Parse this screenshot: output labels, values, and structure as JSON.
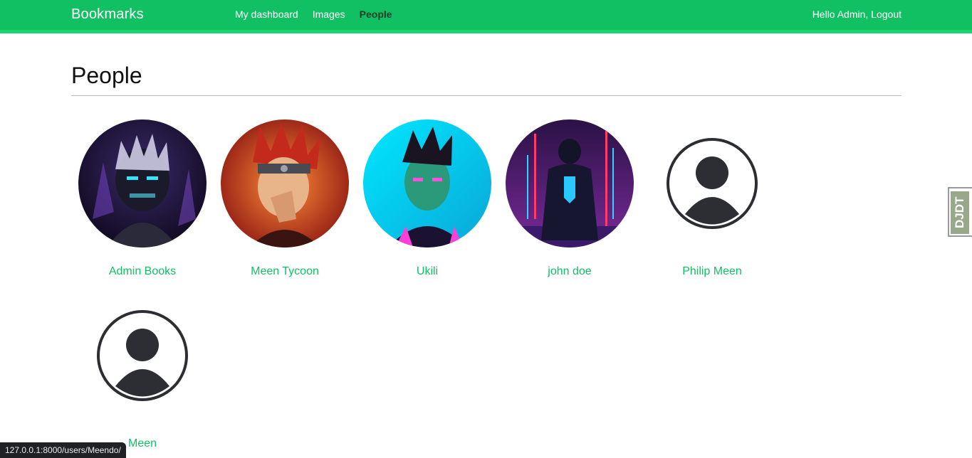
{
  "header": {
    "logo": "Bookmarks",
    "menu": [
      {
        "label": "My dashboard",
        "selected": false
      },
      {
        "label": "Images",
        "selected": false
      },
      {
        "label": "People",
        "selected": true
      }
    ],
    "greeting": "Hello Admin,",
    "logout_label": "Logout"
  },
  "page": {
    "title": "People"
  },
  "people": [
    {
      "name": "Admin Books",
      "avatar": "dark-anime-purple"
    },
    {
      "name": "Meen Tycoon",
      "avatar": "anime-fire-red"
    },
    {
      "name": "Ukili",
      "avatar": "cyber-teal-portrait"
    },
    {
      "name": "john doe",
      "avatar": "neon-city-figure"
    },
    {
      "name": "Philip Meen",
      "avatar": "default-user-icon"
    },
    {
      "name": "Meen",
      "avatar": "default-user-icon"
    }
  ],
  "debug_toolbar": {
    "label": "DJDT"
  },
  "status_bar": {
    "url": "127.0.0.1:8000/users/Meendo/"
  },
  "colors": {
    "accent": "#12c064",
    "header_border": "#19d66f",
    "selected_menu": "#1a3e2a"
  }
}
